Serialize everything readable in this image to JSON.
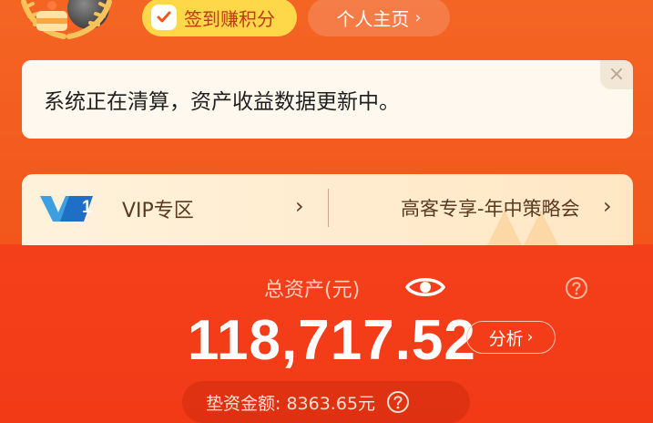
{
  "header": {
    "sign_in_label": "签到赚积分",
    "home_label": "个人主页",
    "home_chevron": "›"
  },
  "notice": {
    "text": "系统正在清算，资产收益数据更新中。",
    "close": "×"
  },
  "vip": {
    "logo_text": "1",
    "label": "VIP专区",
    "promo": "高客专享-年中策略会",
    "chevron": "›"
  },
  "assets": {
    "label": "总资产(元)",
    "value": "118,717.52",
    "analysis_label": "分析",
    "analysis_chevron": "›",
    "advance_label": "垫资金额: 8363.65元"
  },
  "colors": {
    "background": "#f25a1e",
    "accent_yellow": "#ffd84a",
    "notice_bg": "#fff8ee",
    "vip_bg": "#ffe7c4"
  },
  "icons": [
    "cake-badge-icon",
    "checkmark-icon",
    "close-icon",
    "vip-logo-icon",
    "eye-icon",
    "help-icon"
  ]
}
